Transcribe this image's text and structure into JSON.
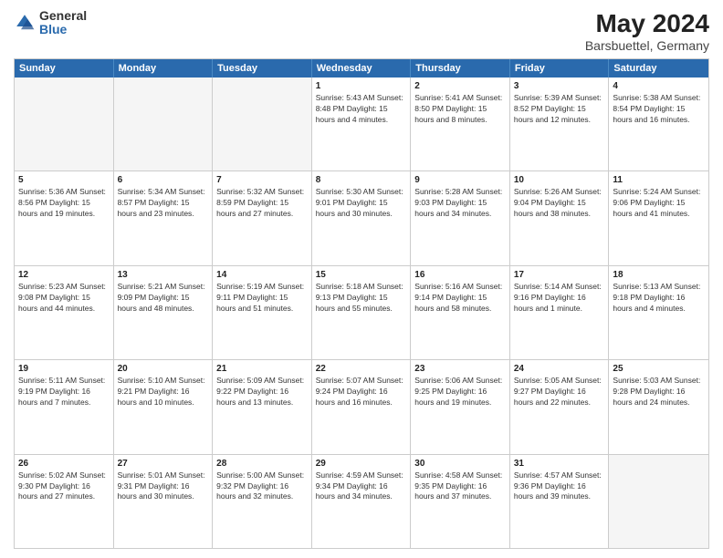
{
  "logo": {
    "general": "General",
    "blue": "Blue"
  },
  "title": "May 2024",
  "location": "Barsbuettel, Germany",
  "days_of_week": [
    "Sunday",
    "Monday",
    "Tuesday",
    "Wednesday",
    "Thursday",
    "Friday",
    "Saturday"
  ],
  "rows": [
    [
      {
        "day": "",
        "info": "",
        "empty": true
      },
      {
        "day": "",
        "info": "",
        "empty": true
      },
      {
        "day": "",
        "info": "",
        "empty": true
      },
      {
        "day": "1",
        "info": "Sunrise: 5:43 AM\nSunset: 8:48 PM\nDaylight: 15 hours\nand 4 minutes."
      },
      {
        "day": "2",
        "info": "Sunrise: 5:41 AM\nSunset: 8:50 PM\nDaylight: 15 hours\nand 8 minutes."
      },
      {
        "day": "3",
        "info": "Sunrise: 5:39 AM\nSunset: 8:52 PM\nDaylight: 15 hours\nand 12 minutes."
      },
      {
        "day": "4",
        "info": "Sunrise: 5:38 AM\nSunset: 8:54 PM\nDaylight: 15 hours\nand 16 minutes."
      }
    ],
    [
      {
        "day": "5",
        "info": "Sunrise: 5:36 AM\nSunset: 8:56 PM\nDaylight: 15 hours\nand 19 minutes."
      },
      {
        "day": "6",
        "info": "Sunrise: 5:34 AM\nSunset: 8:57 PM\nDaylight: 15 hours\nand 23 minutes."
      },
      {
        "day": "7",
        "info": "Sunrise: 5:32 AM\nSunset: 8:59 PM\nDaylight: 15 hours\nand 27 minutes."
      },
      {
        "day": "8",
        "info": "Sunrise: 5:30 AM\nSunset: 9:01 PM\nDaylight: 15 hours\nand 30 minutes."
      },
      {
        "day": "9",
        "info": "Sunrise: 5:28 AM\nSunset: 9:03 PM\nDaylight: 15 hours\nand 34 minutes."
      },
      {
        "day": "10",
        "info": "Sunrise: 5:26 AM\nSunset: 9:04 PM\nDaylight: 15 hours\nand 38 minutes."
      },
      {
        "day": "11",
        "info": "Sunrise: 5:24 AM\nSunset: 9:06 PM\nDaylight: 15 hours\nand 41 minutes."
      }
    ],
    [
      {
        "day": "12",
        "info": "Sunrise: 5:23 AM\nSunset: 9:08 PM\nDaylight: 15 hours\nand 44 minutes."
      },
      {
        "day": "13",
        "info": "Sunrise: 5:21 AM\nSunset: 9:09 PM\nDaylight: 15 hours\nand 48 minutes."
      },
      {
        "day": "14",
        "info": "Sunrise: 5:19 AM\nSunset: 9:11 PM\nDaylight: 15 hours\nand 51 minutes."
      },
      {
        "day": "15",
        "info": "Sunrise: 5:18 AM\nSunset: 9:13 PM\nDaylight: 15 hours\nand 55 minutes."
      },
      {
        "day": "16",
        "info": "Sunrise: 5:16 AM\nSunset: 9:14 PM\nDaylight: 15 hours\nand 58 minutes."
      },
      {
        "day": "17",
        "info": "Sunrise: 5:14 AM\nSunset: 9:16 PM\nDaylight: 16 hours\nand 1 minute."
      },
      {
        "day": "18",
        "info": "Sunrise: 5:13 AM\nSunset: 9:18 PM\nDaylight: 16 hours\nand 4 minutes."
      }
    ],
    [
      {
        "day": "19",
        "info": "Sunrise: 5:11 AM\nSunset: 9:19 PM\nDaylight: 16 hours\nand 7 minutes."
      },
      {
        "day": "20",
        "info": "Sunrise: 5:10 AM\nSunset: 9:21 PM\nDaylight: 16 hours\nand 10 minutes."
      },
      {
        "day": "21",
        "info": "Sunrise: 5:09 AM\nSunset: 9:22 PM\nDaylight: 16 hours\nand 13 minutes."
      },
      {
        "day": "22",
        "info": "Sunrise: 5:07 AM\nSunset: 9:24 PM\nDaylight: 16 hours\nand 16 minutes."
      },
      {
        "day": "23",
        "info": "Sunrise: 5:06 AM\nSunset: 9:25 PM\nDaylight: 16 hours\nand 19 minutes."
      },
      {
        "day": "24",
        "info": "Sunrise: 5:05 AM\nSunset: 9:27 PM\nDaylight: 16 hours\nand 22 minutes."
      },
      {
        "day": "25",
        "info": "Sunrise: 5:03 AM\nSunset: 9:28 PM\nDaylight: 16 hours\nand 24 minutes."
      }
    ],
    [
      {
        "day": "26",
        "info": "Sunrise: 5:02 AM\nSunset: 9:30 PM\nDaylight: 16 hours\nand 27 minutes."
      },
      {
        "day": "27",
        "info": "Sunrise: 5:01 AM\nSunset: 9:31 PM\nDaylight: 16 hours\nand 30 minutes."
      },
      {
        "day": "28",
        "info": "Sunrise: 5:00 AM\nSunset: 9:32 PM\nDaylight: 16 hours\nand 32 minutes."
      },
      {
        "day": "29",
        "info": "Sunrise: 4:59 AM\nSunset: 9:34 PM\nDaylight: 16 hours\nand 34 minutes."
      },
      {
        "day": "30",
        "info": "Sunrise: 4:58 AM\nSunset: 9:35 PM\nDaylight: 16 hours\nand 37 minutes."
      },
      {
        "day": "31",
        "info": "Sunrise: 4:57 AM\nSunset: 9:36 PM\nDaylight: 16 hours\nand 39 minutes."
      },
      {
        "day": "",
        "info": "",
        "empty": true
      }
    ]
  ]
}
